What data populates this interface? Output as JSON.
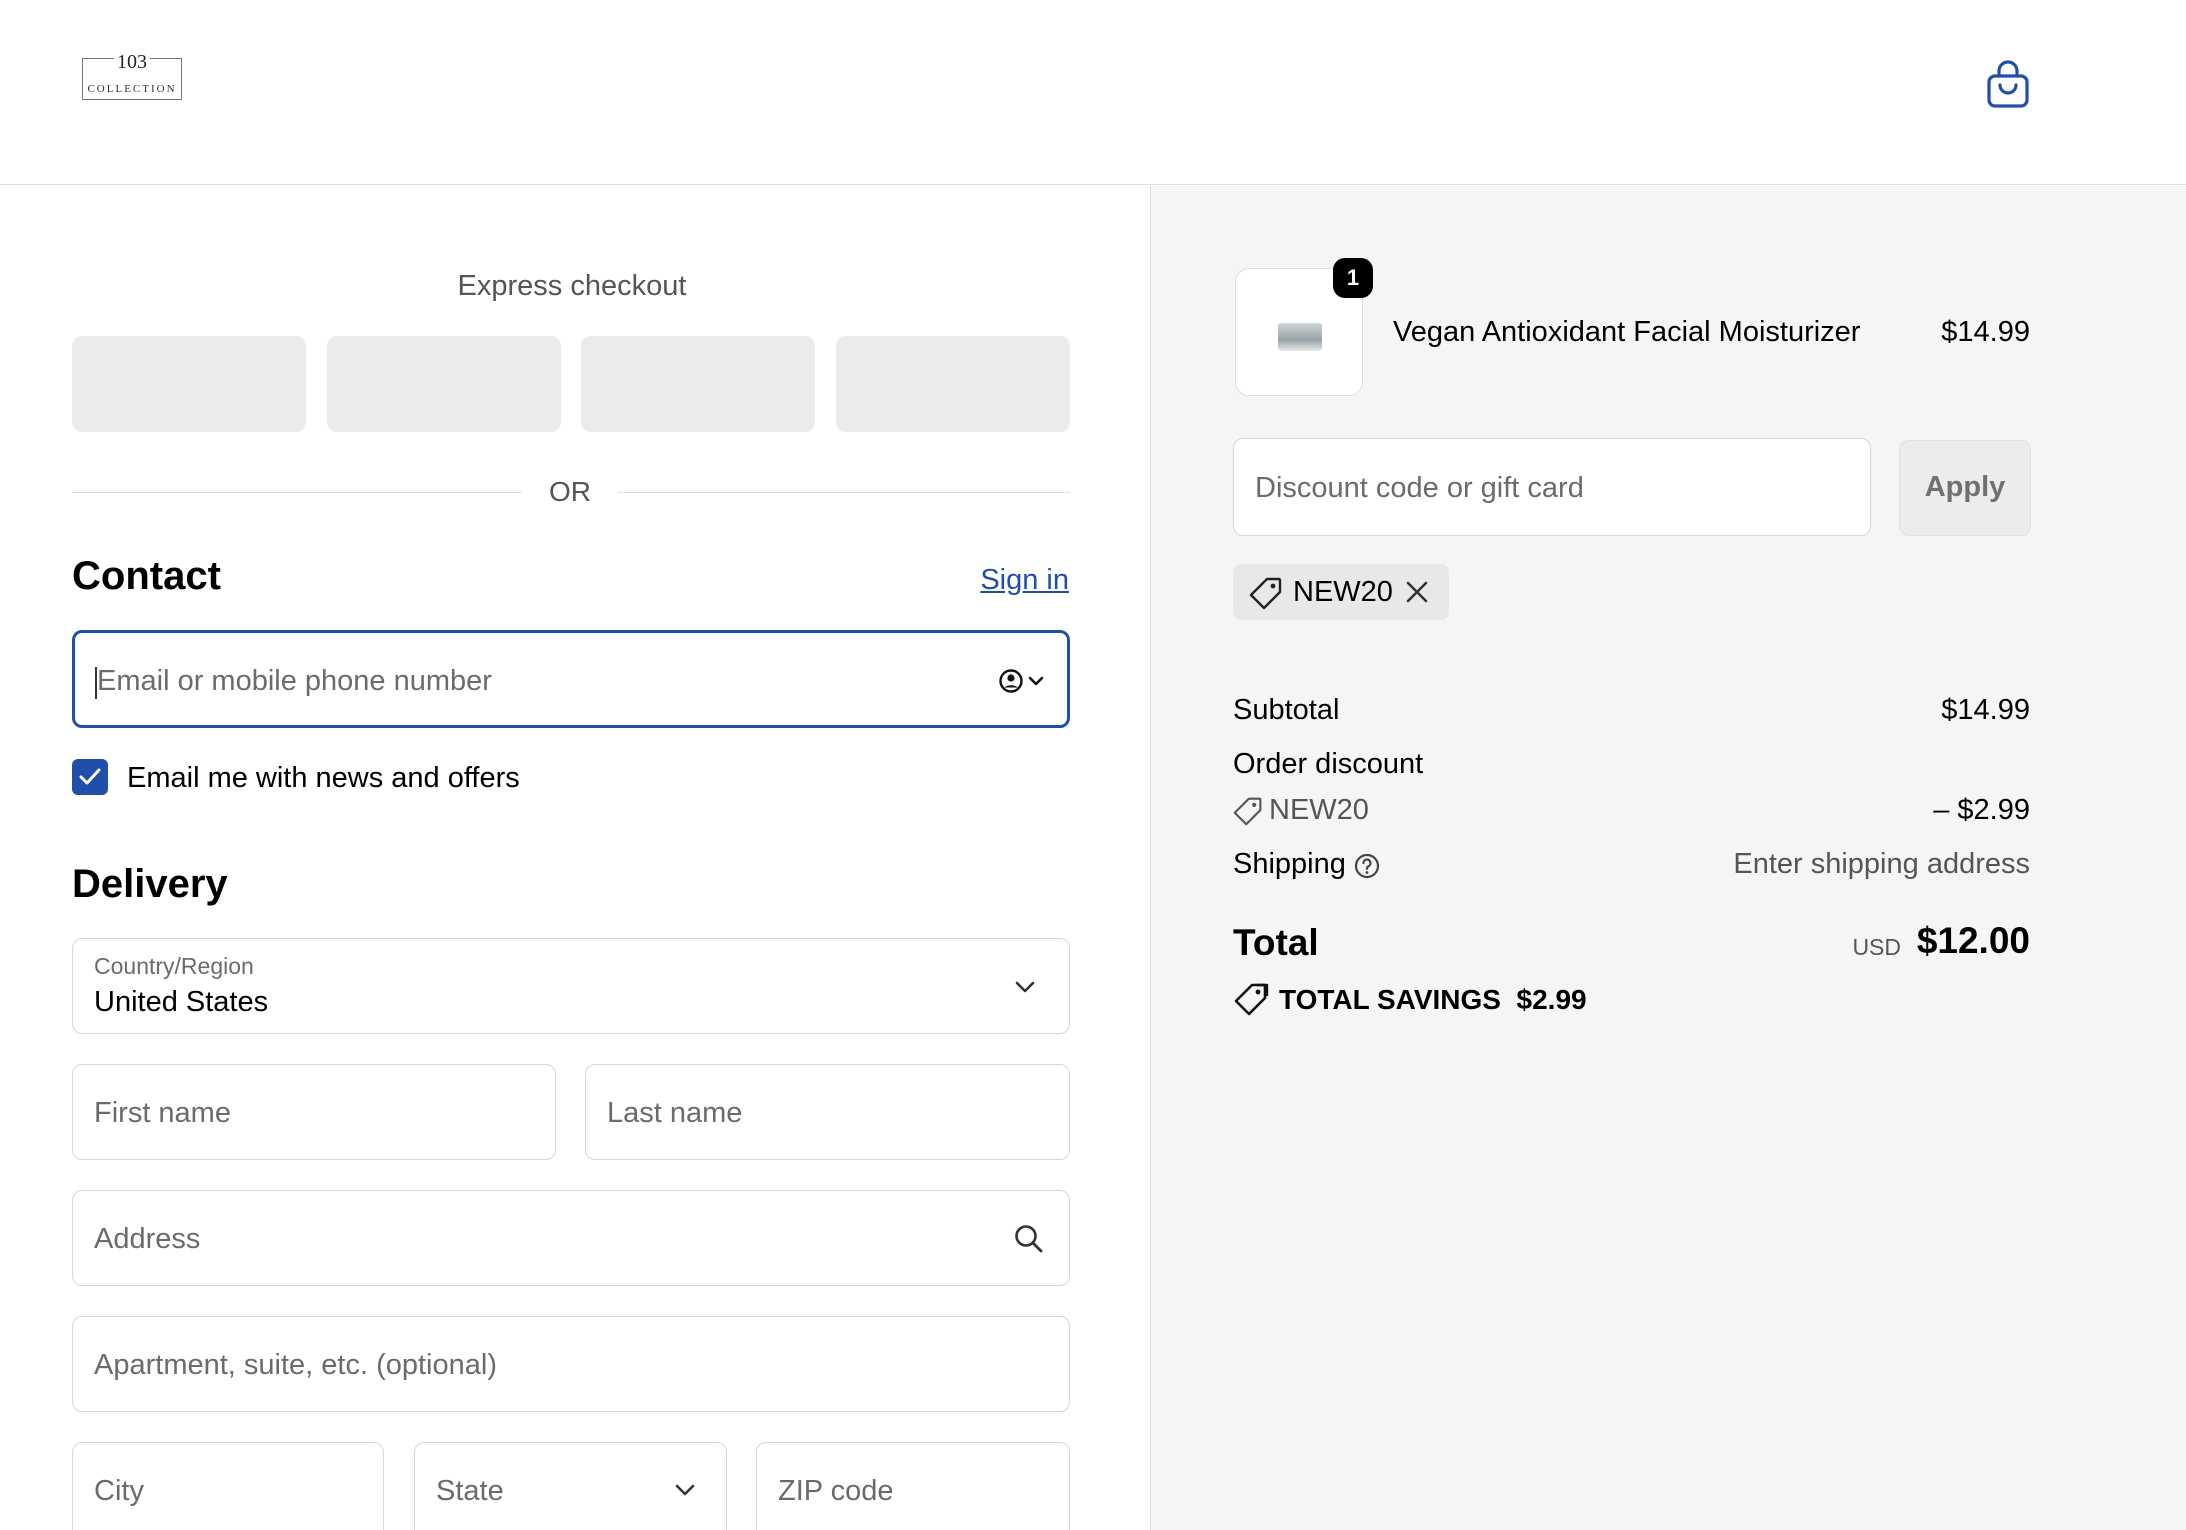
{
  "header": {
    "logo_number": "103",
    "logo_word": "COLLECTION"
  },
  "express": {
    "title": "Express checkout",
    "or_text": "OR"
  },
  "contact": {
    "heading": "Contact",
    "sign_in": "Sign in",
    "email_placeholder": "Email or mobile phone number",
    "newsletter_label": "Email me with news and offers",
    "newsletter_checked": true
  },
  "delivery": {
    "heading": "Delivery",
    "country_label": "Country/Region",
    "country_value": "United States",
    "first_name_placeholder": "First name",
    "last_name_placeholder": "Last name",
    "address_placeholder": "Address",
    "apartment_placeholder": "Apartment, suite, etc. (optional)",
    "city_placeholder": "City",
    "state_placeholder": "State",
    "zip_placeholder": "ZIP code"
  },
  "summary": {
    "product": {
      "name": "Vegan Antioxidant Facial Moisturizer",
      "price": "$14.99",
      "quantity": "1"
    },
    "discount_placeholder": "Discount code or gift card",
    "apply_label": "Apply",
    "applied_code": "NEW20",
    "subtotal_label": "Subtotal",
    "subtotal_value": "$14.99",
    "order_discount_label": "Order discount",
    "discount_code": "NEW20",
    "discount_value": "– $2.99",
    "shipping_label": "Shipping",
    "shipping_value": "Enter shipping address",
    "total_label": "Total",
    "total_currency": "USD",
    "total_value": "$12.00",
    "savings_label": "TOTAL SAVINGS",
    "savings_value": "$2.99"
  },
  "colors": {
    "accent": "#1f4fa8",
    "right_panel_bg": "#f5f5f5",
    "express_button_bg": "#ebebeb"
  }
}
